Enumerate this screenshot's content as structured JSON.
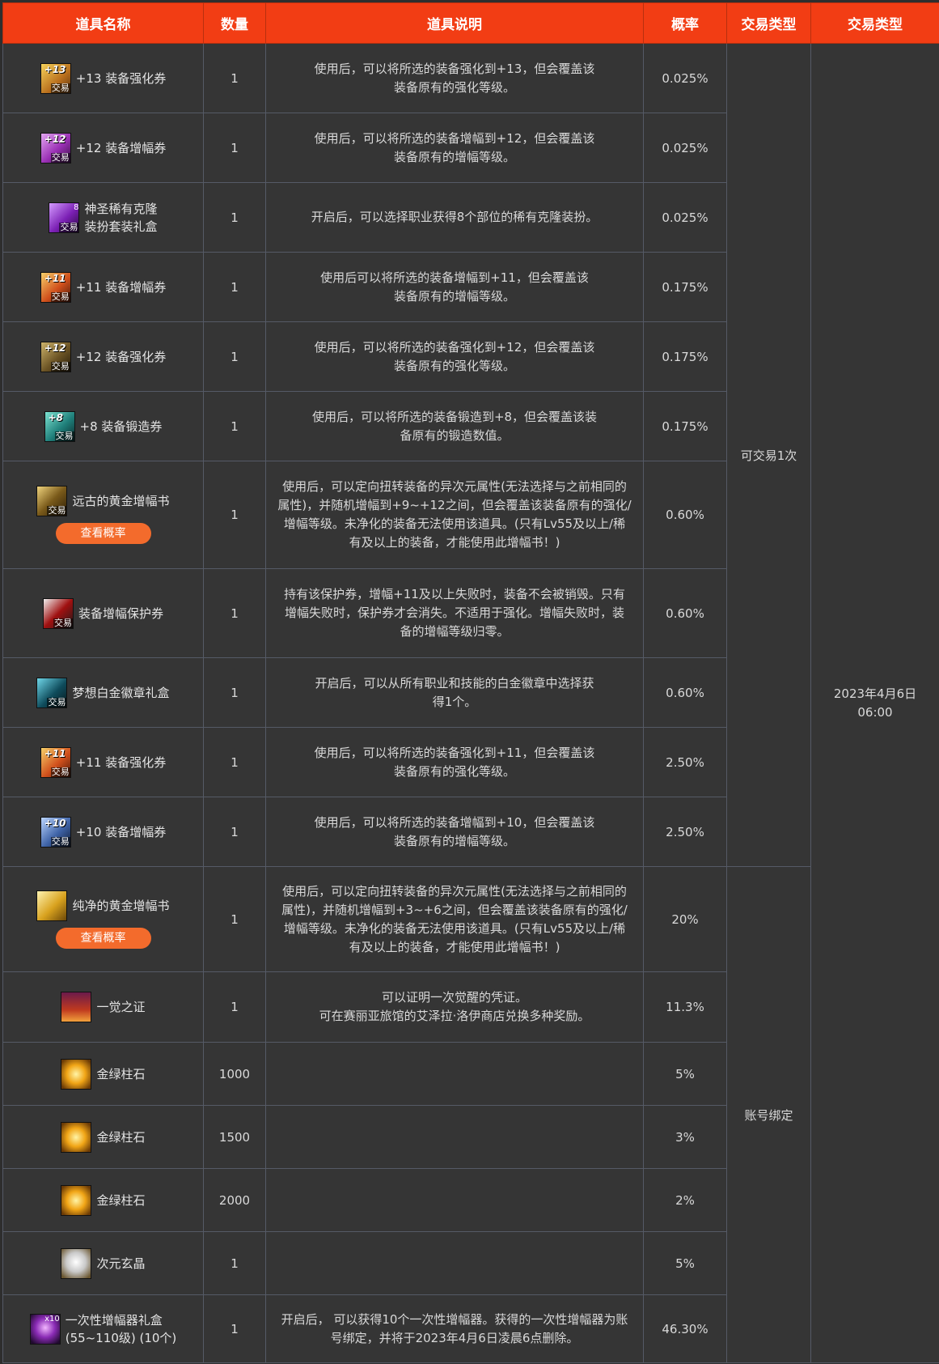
{
  "headers": {
    "name": "道具名称",
    "qty": "数量",
    "desc": "道具说明",
    "prob": "概率",
    "trade": "交易类型",
    "time": "交易类型"
  },
  "button_label": "查看概率",
  "trade_groups": {
    "once": "可交易1次",
    "bound": "账号绑定"
  },
  "time_value": "2023年4月6日\n06:00",
  "rows": [
    {
      "name": "+13 装备强化券",
      "qty": "1",
      "desc": "使用后，可以将所选的装备强化到+13，但会覆盖该\n装备原有的强化等级。",
      "prob": "0.025%",
      "icon": "reinforce-13-icon",
      "level": "+13",
      "tag": "交易"
    },
    {
      "name": "+12 装备增幅券",
      "qty": "1",
      "desc": "使用后，可以将所选的装备增幅到+12，但会覆盖该\n装备原有的增幅等级。",
      "prob": "0.025%",
      "icon": "amplify-12-icon",
      "level": "+12",
      "tag": "交易"
    },
    {
      "name": "神圣稀有克隆\n装扮套装礼盒",
      "qty": "1",
      "desc": "开启后，可以选择职业获得8个部位的稀有克隆装扮。",
      "prob": "0.025%",
      "icon": "clone-avatar-box-icon",
      "level": "",
      "tag": "交易",
      "count": "8"
    },
    {
      "name": "+11 装备增幅券",
      "qty": "1",
      "desc": "使用后可以将所选的装备增幅到+11，但会覆盖该\n装备原有的增幅等级。",
      "prob": "0.175%",
      "icon": "amplify-11-icon",
      "level": "+11",
      "tag": "交易"
    },
    {
      "name": "+12 装备强化券",
      "qty": "1",
      "desc": "使用后，可以将所选的装备强化到+12，但会覆盖该\n装备原有的强化等级。",
      "prob": "0.175%",
      "icon": "reinforce-12-icon",
      "level": "+12",
      "tag": "交易"
    },
    {
      "name": "+8 装备锻造券",
      "qty": "1",
      "desc": "使用后，可以将所选的装备锻造到+8，但会覆盖该装\n备原有的锻造数值。",
      "prob": "0.175%",
      "icon": "refine-8-icon",
      "level": "+8",
      "tag": "交易"
    },
    {
      "name": "远古的黄金增幅书",
      "qty": "1",
      "desc": "使用后，可以定向扭转装备的异次元属性(无法选择与之前相同的\n属性)，并随机增幅到+9~+12之间，但会覆盖该装备原有的强化/\n增幅等级。未净化的装备无法使用该道具。(只有Lv55及以上/稀\n有及以上的装备，才能使用此增幅书！)",
      "prob": "0.60%",
      "icon": "ancient-gold-book-icon",
      "level": "",
      "tag": "交易",
      "button": true
    },
    {
      "name": "装备增幅保护券",
      "qty": "1",
      "desc": "持有该保护券，增幅+11及以上失败时，装备不会被销毁。只有\n增幅失败时，保护券才会消失。不适用于强化。增幅失败时，装\n备的增幅等级归零。",
      "prob": "0.60%",
      "icon": "amplify-protect-icon",
      "level": "",
      "tag": "交易"
    },
    {
      "name": "梦想白金徽章礼盒",
      "qty": "1",
      "desc": "开启后，可以从所有职业和技能的白金徽章中选择获\n得1个。",
      "prob": "0.60%",
      "icon": "platinum-emblem-box-icon",
      "level": "",
      "tag": "交易"
    },
    {
      "name": "+11 装备强化券",
      "qty": "1",
      "desc": "使用后，可以将所选的装备强化到+11，但会覆盖该\n装备原有的强化等级。",
      "prob": "2.50%",
      "icon": "reinforce-11-icon",
      "level": "+11",
      "tag": "交易"
    },
    {
      "name": "+10 装备增幅券",
      "qty": "1",
      "desc": "使用后，可以将所选的装备增幅到+10，但会覆盖该\n装备原有的增幅等级。",
      "prob": "2.50%",
      "icon": "amplify-10-icon",
      "level": "+10",
      "tag": "交易"
    },
    {
      "name": "纯净的黄金增幅书",
      "qty": "1",
      "desc": "使用后，可以定向扭转装备的异次元属性(无法选择与之前相同的\n属性)，并随机增幅到+3~+6之间，但会覆盖该装备原有的强化/\n增幅等级。未净化的装备无法使用该道具。(只有Lv55及以上/稀\n有及以上的装备，才能使用此增幅书！)",
      "prob": "20%",
      "icon": "pure-gold-book-icon",
      "level": "",
      "tag": "",
      "button": true
    },
    {
      "name": "一觉之证",
      "qty": "1",
      "desc": "可以证明一次觉醒的凭证。\n可在赛丽亚旅馆的艾泽拉·洛伊商店兑换多种奖励。",
      "prob": "11.3%",
      "icon": "awakening-proof-icon",
      "level": "",
      "tag": ""
    },
    {
      "name": "金绿柱石",
      "qty": "1000",
      "desc": "",
      "prob": "5%",
      "icon": "chrysoberyl-icon",
      "level": "",
      "tag": ""
    },
    {
      "name": "金绿柱石",
      "qty": "1500",
      "desc": "",
      "prob": "3%",
      "icon": "chrysoberyl-icon",
      "level": "",
      "tag": ""
    },
    {
      "name": "金绿柱石",
      "qty": "2000",
      "desc": "",
      "prob": "2%",
      "icon": "chrysoberyl-icon",
      "level": "",
      "tag": ""
    },
    {
      "name": "次元玄晶",
      "qty": "1",
      "desc": "",
      "prob": "5%",
      "icon": "dimension-crystal-icon",
      "level": "",
      "tag": ""
    },
    {
      "name": "一次性增幅器礼盒\n(55~110级) (10个)",
      "qty": "1",
      "desc": "开启后， 可以获得10个一次性增幅器。获得的一次性增幅器为账\n号绑定，并将于2023年4月6日凌晨6点删除。",
      "prob": "46.30%",
      "icon": "amplifier-box-icon",
      "level": "",
      "tag": "",
      "count": "x10"
    }
  ]
}
